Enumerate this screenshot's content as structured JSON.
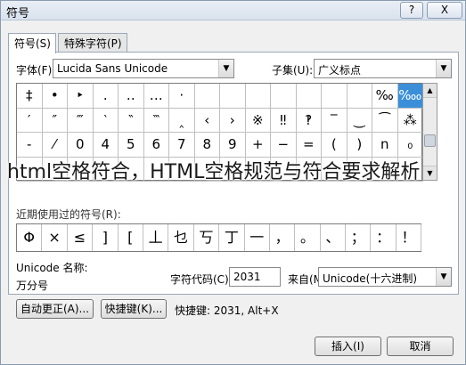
{
  "window": {
    "title": "符号",
    "help_label": "?",
    "close_label": "X"
  },
  "tabs": [
    {
      "label": "符号(S)"
    },
    {
      "label": "特殊字符(P)"
    }
  ],
  "font": {
    "label": "字体(F):",
    "value": "Lucida Sans Unicode"
  },
  "subset": {
    "label": "子集(U):",
    "value": "广义标点"
  },
  "symbols": [
    [
      "‡",
      "•",
      "‣",
      "․",
      "‥",
      "…",
      "‧",
      "",
      "",
      "",
      "",
      "",
      "",
      "",
      "‰",
      "‱"
    ],
    [
      "′",
      "″",
      "‴",
      "‵",
      "‶",
      "‷",
      "‸",
      "‹",
      "›",
      "※",
      "‼",
      "‽",
      "‾",
      "‿",
      "⁀",
      "⁂"
    ],
    [
      "-",
      "⁄",
      "0",
      "4",
      "5",
      "6",
      "7",
      "8",
      "9",
      "+",
      "−",
      "=",
      "(",
      ")",
      "n",
      "₀"
    ],
    [
      "",
      "",
      "",
      "",
      "",
      "",
      "",
      "",
      "",
      "",
      "",
      "",
      "",
      "",
      "",
      ""
    ]
  ],
  "selected_symbol": "‱",
  "recent": {
    "label": "近期使用过的符号(R):",
    "items": [
      "Φ",
      "×",
      "≤",
      "]",
      "[",
      "丄",
      "乜",
      "丂",
      "丁",
      "一",
      "，",
      "。",
      "、",
      "；",
      "：",
      "！"
    ]
  },
  "unicode_name": {
    "label": "Unicode 名称:",
    "value": "万分号"
  },
  "char_code": {
    "label": "字符代码(C):",
    "value": "2031"
  },
  "from": {
    "label": "来自(M):",
    "value": "Unicode(十六进制)"
  },
  "buttons": {
    "autocorrect": "自动更正(A)...",
    "shortcut": "快捷键(K)...",
    "shortcut_text": "快捷键: 2031, Alt+X",
    "insert": "插入(I)",
    "cancel": "取消"
  },
  "overlay_text": "html空格符合，HTML空格规范与符合要求解析"
}
